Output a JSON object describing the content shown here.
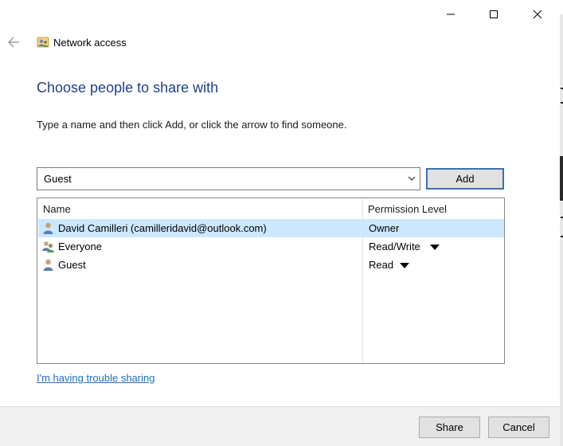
{
  "window": {
    "title": "Network access",
    "heading": "Choose people to share with",
    "instruction": "Type a name and then click Add, or click the arrow to find someone."
  },
  "icons": {
    "back": "back-arrow-icon",
    "title": "network-users-icon",
    "minimize": "minimize-icon",
    "maximize": "maximize-icon",
    "close": "close-icon",
    "dropdown": "chevron-down-icon"
  },
  "picker": {
    "value": "Guest",
    "add_label": "Add"
  },
  "list": {
    "columns": {
      "name": "Name",
      "permission": "Permission Level"
    },
    "rows": [
      {
        "name": "David Camilleri (camilleridavid@outlook.com)",
        "permission": "Owner",
        "icon": "user-icon",
        "selected": true,
        "has_dropdown": false
      },
      {
        "name": "Everyone",
        "permission": "Read/Write",
        "icon": "group-users-icon",
        "selected": false,
        "has_dropdown": true
      },
      {
        "name": "Guest",
        "permission": "Read",
        "icon": "user-icon",
        "selected": false,
        "has_dropdown": true
      }
    ]
  },
  "links": {
    "trouble": "I'm having trouble sharing"
  },
  "footer": {
    "share_label": "Share",
    "cancel_label": "Cancel"
  },
  "colors": {
    "heading": "#1e3f8a",
    "link": "#1f6fbf",
    "selection": "#cce8ff",
    "default_button_border": "#3c6fb3"
  }
}
